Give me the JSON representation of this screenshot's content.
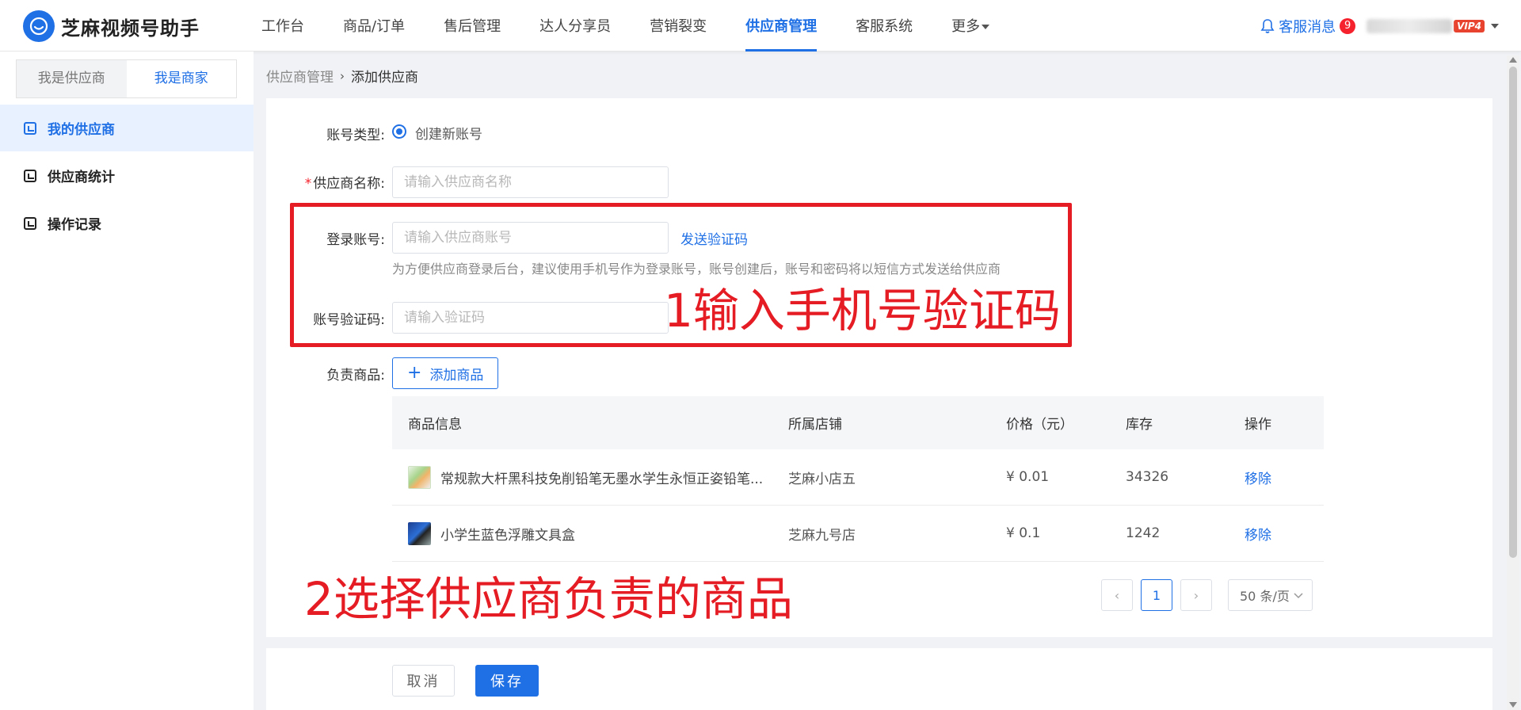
{
  "app": {
    "title": "芝麻视频号助手"
  },
  "nav": {
    "items": [
      "工作台",
      "商品/订单",
      "售后管理",
      "达人分享员",
      "营销裂变",
      "供应商管理",
      "客服系统",
      "更多"
    ],
    "active_index": 5
  },
  "topright": {
    "cs_label": "客服消息",
    "cs_badge": "9",
    "account": "13217176283",
    "vip": "VIP4"
  },
  "sidebar": {
    "role_tabs": [
      "我是供应商",
      "我是商家"
    ],
    "active_role": 1,
    "menu": [
      "我的供应商",
      "供应商统计",
      "操作记录"
    ],
    "active_menu": 0
  },
  "breadcrumb": {
    "parent": "供应商管理",
    "sep": "›",
    "current": "添加供应商"
  },
  "form": {
    "account_type_label": "账号类型:",
    "account_type_option": "创建新账号",
    "required_mark": "*",
    "name_label": "供应商名称:",
    "name_placeholder": "请输入供应商名称",
    "login_label": "登录账号:",
    "login_placeholder": "请输入供应商账号",
    "send_code": "发送验证码",
    "hint": "为方便供应商登录后台，建议使用手机号作为登录账号，账号创建后，账号和密码将以短信方式发送给供应商",
    "code_label": "账号验证码:",
    "code_placeholder": "请输入验证码",
    "goods_label": "负责商品:",
    "add_goods": "添加商品"
  },
  "table": {
    "headers": [
      "商品信息",
      "所属店铺",
      "价格（元）",
      "库存",
      "操作"
    ],
    "rows": [
      {
        "name": "常规款大杆黑科技免削铅笔无墨水学生永恒正姿铅笔...",
        "shop": "芝麻小店五",
        "price": "¥ 0.01",
        "stock": "34326",
        "action": "移除"
      },
      {
        "name": "小学生蓝色浮雕文具盒",
        "shop": "芝麻九号店",
        "price": "¥ 0.1",
        "stock": "1242",
        "action": "移除"
      }
    ]
  },
  "pager": {
    "prev": "‹",
    "page": "1",
    "next": "›",
    "size": "50 条/页"
  },
  "footer": {
    "cancel": "取消",
    "save": "保存"
  },
  "annotations": {
    "step1": "1输入手机号验证码",
    "step2": "2选择供应商负责的商品"
  },
  "colors": {
    "primary": "#1f6fe5",
    "annotation": "#e51c23",
    "badge": "#f5222d"
  }
}
